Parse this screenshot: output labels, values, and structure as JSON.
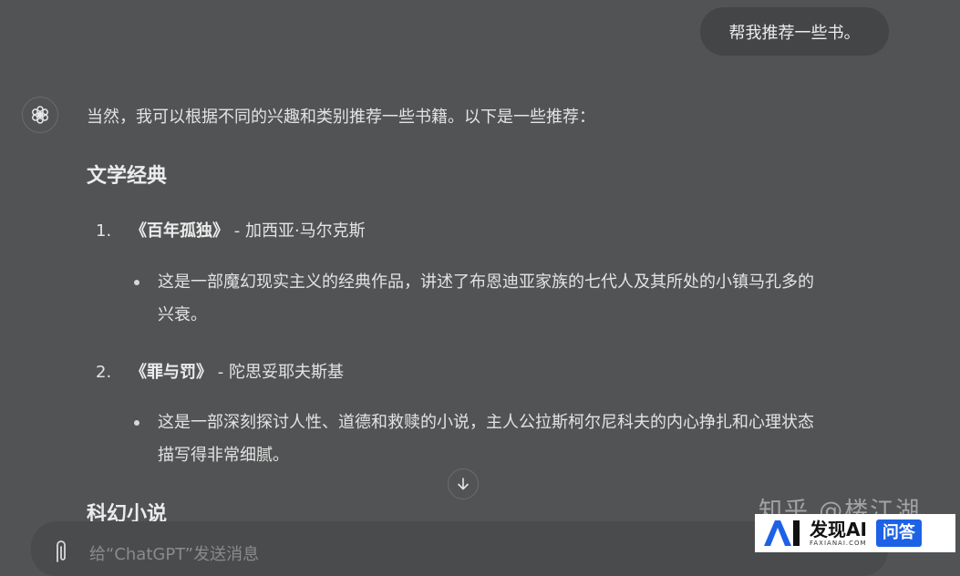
{
  "user_message": "帮我推荐一些书。",
  "assistant": {
    "intro": "当然，我可以根据不同的兴趣和类别推荐一些书籍。以下是一些推荐：",
    "sections": [
      {
        "heading": "文学经典",
        "books": [
          {
            "number": "1.",
            "title": "《百年孤独》",
            "author": " - 加西亚·马尔克斯",
            "description_lines": [
              "这是一部魔幻现实主义的经典作品，讲述了布恩迪亚家族的七代人及其所处的小镇马孔多的",
              "兴衰。"
            ]
          },
          {
            "number": "2.",
            "title": "《罪与罚》",
            "author": " - 陀思妥耶夫斯基",
            "description_lines": [
              "这是一部深刻探讨人性、道德和救赎的小说，主人公拉斯柯尔尼科夫的内心挣扎和心理状态",
              "描写得非常细腻。"
            ]
          }
        ]
      },
      {
        "heading": "科幻小说"
      }
    ]
  },
  "composer": {
    "placeholder": "给“ChatGPT”发送消息"
  },
  "watermark": "知乎 @楼江湖",
  "badge": {
    "brand": "发现AI",
    "brand_sub": "FAXIANAI.COM",
    "qa": "问答",
    "accent": "#1d62e6"
  },
  "colors": {
    "background": "#525354",
    "bubble": "#444546",
    "text": "#e3e3e3"
  },
  "icons": {
    "avatar": "openai-logo-icon",
    "scroll": "arrow-down-icon",
    "attach": "paperclip-icon"
  }
}
